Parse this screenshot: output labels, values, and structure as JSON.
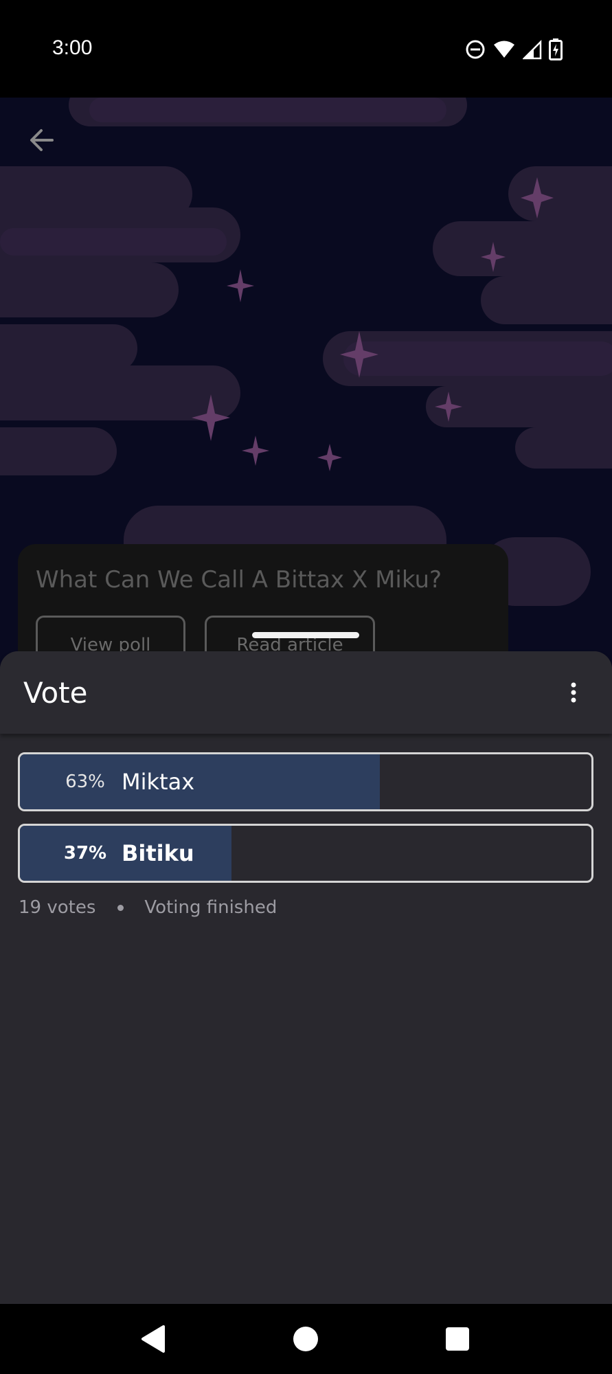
{
  "status_bar": {
    "time": "3:00",
    "icons": [
      "do-not-disturb-icon",
      "wifi-icon",
      "signal-icon",
      "battery-charging-icon"
    ]
  },
  "hero": {
    "back_icon": "arrow-back-icon"
  },
  "article_card": {
    "title": "What Can We Call A Bittax X Miku?",
    "view_poll_label": "View poll",
    "read_article_label": "Read article"
  },
  "sheet": {
    "title": "Vote",
    "menu_icon": "more-vert-icon",
    "options": [
      {
        "label": "Miktax",
        "percent_text": "63%",
        "percent": 63,
        "winner": false
      },
      {
        "label": "Bitiku",
        "percent_text": "37%",
        "percent": 37,
        "winner": true
      }
    ],
    "votes_text": "19 votes",
    "status_text": "Voting finished"
  },
  "nav_bar": {
    "buttons": [
      "back-nav-icon",
      "home-nav-icon",
      "recents-nav-icon"
    ]
  },
  "colors": {
    "sheet_background": "#29282e",
    "poll_fill": "#2d3e5e",
    "poll_border": "#d5d5d5",
    "meta_text": "#9d9ca3",
    "hero_background": "#0b0b22",
    "cloud_color": "#3a2a4e",
    "star_color": "#7a4a7e"
  }
}
